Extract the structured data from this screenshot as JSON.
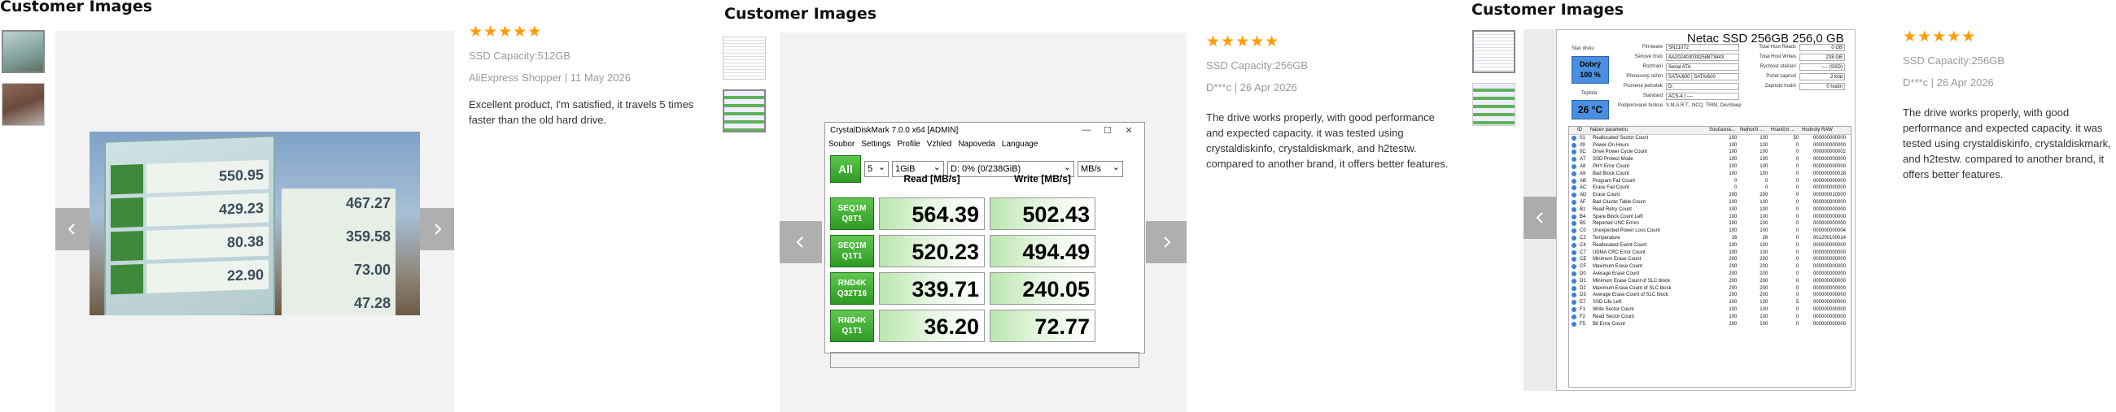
{
  "panels": [
    {
      "title": "Customer Images",
      "rating": "★★★★★",
      "meta_capacity": "SSD Capacity:512GB",
      "meta_author": "AliExpress Shopper | 11 May 2026",
      "text": "Excellent product, I'm satisfied, it travels 5 times faster than the old hard drive.",
      "photo_values": [
        "550.95",
        "467.27",
        "429.23",
        "359.58",
        "80.38",
        "73.00",
        "22.90",
        "47.28"
      ]
    },
    {
      "title": "Customer Images",
      "rating": "★★★★★",
      "meta_capacity": "SSD Capacity:256GB",
      "meta_author": "D***c | 26 Apr 2026",
      "text": "The drive works properly, with good performance and expected capacity. it was tested using crystaldiskinfo, crystaldiskmark, and h2testw. compared to another brand, it offers better features."
    },
    {
      "title": "Customer Images",
      "rating": "★★★★★",
      "meta_capacity": "SSD Capacity:256GB",
      "meta_author": "D***c | 26 Apr 2026",
      "text": "The drive works properly, with good performance and expected capacity. it was tested using crystaldiskinfo, crystaldiskmark, and h2testw. compared to another brand, it offers better features."
    }
  ],
  "cdm": {
    "title": "CrystalDiskMark 7.0.0 x64 [ADMIN]",
    "menu": [
      "Soubor",
      "Settings",
      "Profile",
      "Vzhled",
      "Napoveda",
      "Language"
    ],
    "all_label": "All",
    "count": "5",
    "size": "1GiB",
    "drive": "D: 0% (0/238GiB)",
    "unit": "MB/s",
    "read_header": "Read [MB/s]",
    "write_header": "Write [MB/s]",
    "rows": [
      {
        "l1": "SEQ1M",
        "l2": "Q8T1",
        "read": "564.39",
        "write": "502.43"
      },
      {
        "l1": "SEQ1M",
        "l2": "Q1T1",
        "read": "520.23",
        "write": "494.49"
      },
      {
        "l1": "RND4K",
        "l2": "Q32T16",
        "read": "339.71",
        "write": "240.05"
      },
      {
        "l1": "RND4K",
        "l2": "Q1T1",
        "read": "36.20",
        "write": "72.77"
      }
    ]
  },
  "cdi": {
    "model": "Netac SSD 256GB 256,0 GB",
    "health_label": "Stav disku",
    "health_status": "Dobrý",
    "health_pct": "100 %",
    "temp_label": "Teplota",
    "temp": "26 °C",
    "fields": [
      {
        "k": "Firmware",
        "v": "SN21072"
      },
      {
        "k": "Sériové číslo",
        "v": "AA202403039258873443"
      },
      {
        "k": "Rozhraní",
        "v": "Serial ATA"
      },
      {
        "k": "Přenosový režim",
        "v": "SATA/600 | SATA/600"
      },
      {
        "k": "Písmena jednotek",
        "v": "D:"
      },
      {
        "k": "Standard",
        "v": "ACS-4 | ----"
      },
      {
        "k": "Podporované funkce",
        "v": "S.M.A.R.T., NCQ, TRIM, DevSleep"
      }
    ],
    "right_fields": [
      {
        "k": "Total Host Reads",
        "v": "0 GB"
      },
      {
        "k": "Total Host Writes",
        "v": "238 GB"
      },
      {
        "k": "Rychlost otáčení",
        "v": "---- (SSD)"
      },
      {
        "k": "Počet zapnutí",
        "v": "2 krát"
      },
      {
        "k": "Zapnuto hodin",
        "v": "0 hodin"
      }
    ],
    "columns": [
      "ID",
      "Název parametru",
      "Současná...",
      "Nejhorší ...",
      "Hranični ...",
      "Hodnoty RAW"
    ],
    "rows": [
      [
        "01",
        "Reallocated Sector Count",
        "100",
        "100",
        "50",
        "000000000000"
      ],
      [
        "09",
        "Power-On Hours",
        "100",
        "100",
        "0",
        "000000000000"
      ],
      [
        "0C",
        "Drive Power Cycle Count",
        "100",
        "100",
        "0",
        "000000000002"
      ],
      [
        "A7",
        "SSD Protect Mode",
        "100",
        "100",
        "0",
        "000000000000"
      ],
      [
        "A8",
        "PHY Error Count",
        "100",
        "100",
        "0",
        "000000000000"
      ],
      [
        "A9",
        "Bad Block Count",
        "100",
        "100",
        "0",
        "000000000028"
      ],
      [
        "AB",
        "Program Fail Count",
        "0",
        "0",
        "0",
        "000000000000"
      ],
      [
        "AC",
        "Erase Fail Count",
        "0",
        "0",
        "0",
        "000000000000"
      ],
      [
        "AD",
        "Erase Count",
        "200",
        "200",
        "0",
        "000000010000"
      ],
      [
        "AF",
        "Bad Cluster Table Count",
        "100",
        "100",
        "0",
        "000000000000"
      ],
      [
        "B1",
        "Read Retry Count",
        "100",
        "100",
        "0",
        "000000000000"
      ],
      [
        "B4",
        "Spare Block Count Left",
        "100",
        "100",
        "0",
        "000000000000"
      ],
      [
        "B5",
        "Reported UNC Errors",
        "100",
        "100",
        "0",
        "000000000000"
      ],
      [
        "C0",
        "Unexpected Power Loss Count",
        "100",
        "100",
        "0",
        "000000000004"
      ],
      [
        "C2",
        "Temperature",
        "26",
        "26",
        "0",
        "001200100014"
      ],
      [
        "C4",
        "Reallocated Event Count",
        "100",
        "100",
        "0",
        "000000000000"
      ],
      [
        "C7",
        "UDMA CRC Error Count",
        "100",
        "100",
        "0",
        "000000000000"
      ],
      [
        "CE",
        "Minimum Erase Count",
        "200",
        "200",
        "0",
        "000000000000"
      ],
      [
        "CF",
        "Maximum Erase Count",
        "200",
        "200",
        "0",
        "000000000000"
      ],
      [
        "D0",
        "Average Erase Count",
        "200",
        "200",
        "0",
        "000000000000"
      ],
      [
        "D1",
        "Minimum Erase Count of SLC block",
        "200",
        "200",
        "0",
        "000000000000"
      ],
      [
        "D2",
        "Maximum Erase Count of SLC block",
        "200",
        "200",
        "0",
        "000000000000"
      ],
      [
        "D3",
        "Average Erase Count of SLC block",
        "200",
        "200",
        "0",
        "000000000000"
      ],
      [
        "E7",
        "SSD Life Left",
        "100",
        "100",
        "5",
        "000000000000"
      ],
      [
        "F1",
        "Write Sector Count",
        "100",
        "100",
        "0",
        "000000000000"
      ],
      [
        "F2",
        "Read Sector Count",
        "100",
        "100",
        "0",
        "000000000000"
      ],
      [
        "F5",
        "Bit Error Count",
        "100",
        "100",
        "0",
        "000000000000"
      ]
    ]
  },
  "icons": {
    "prev": "chevron-left-icon",
    "next": "chevron-right-icon",
    "star": "star-icon"
  },
  "colors": {
    "star": "#ff9c00",
    "meta": "#9a9a9a",
    "cdm_green": "#2e9a24",
    "cdi_blue": "#4a8fe0"
  }
}
